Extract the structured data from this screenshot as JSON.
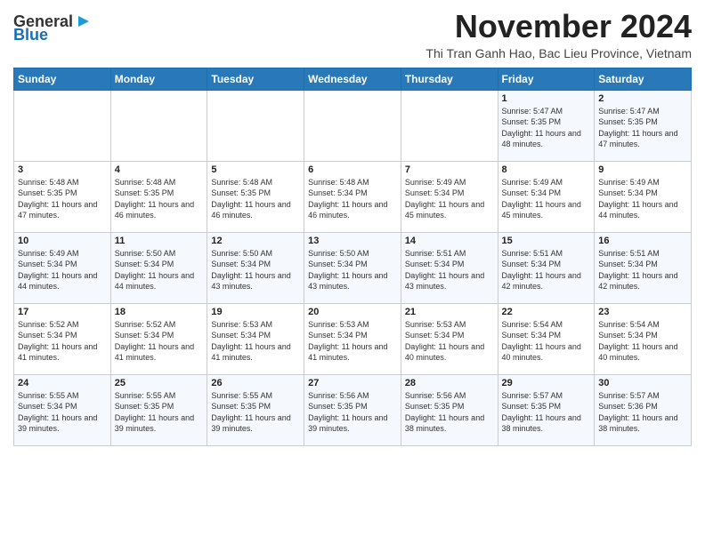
{
  "header": {
    "logo_line1": "General",
    "logo_line2": "Blue",
    "month": "November 2024",
    "location": "Thi Tran Ganh Hao, Bac Lieu Province, Vietnam"
  },
  "days_of_week": [
    "Sunday",
    "Monday",
    "Tuesday",
    "Wednesday",
    "Thursday",
    "Friday",
    "Saturday"
  ],
  "weeks": [
    [
      {
        "day": "",
        "info": ""
      },
      {
        "day": "",
        "info": ""
      },
      {
        "day": "",
        "info": ""
      },
      {
        "day": "",
        "info": ""
      },
      {
        "day": "",
        "info": ""
      },
      {
        "day": "1",
        "info": "Sunrise: 5:47 AM\nSunset: 5:35 PM\nDaylight: 11 hours and 48 minutes."
      },
      {
        "day": "2",
        "info": "Sunrise: 5:47 AM\nSunset: 5:35 PM\nDaylight: 11 hours and 47 minutes."
      }
    ],
    [
      {
        "day": "3",
        "info": "Sunrise: 5:48 AM\nSunset: 5:35 PM\nDaylight: 11 hours and 47 minutes."
      },
      {
        "day": "4",
        "info": "Sunrise: 5:48 AM\nSunset: 5:35 PM\nDaylight: 11 hours and 46 minutes."
      },
      {
        "day": "5",
        "info": "Sunrise: 5:48 AM\nSunset: 5:35 PM\nDaylight: 11 hours and 46 minutes."
      },
      {
        "day": "6",
        "info": "Sunrise: 5:48 AM\nSunset: 5:34 PM\nDaylight: 11 hours and 46 minutes."
      },
      {
        "day": "7",
        "info": "Sunrise: 5:49 AM\nSunset: 5:34 PM\nDaylight: 11 hours and 45 minutes."
      },
      {
        "day": "8",
        "info": "Sunrise: 5:49 AM\nSunset: 5:34 PM\nDaylight: 11 hours and 45 minutes."
      },
      {
        "day": "9",
        "info": "Sunrise: 5:49 AM\nSunset: 5:34 PM\nDaylight: 11 hours and 44 minutes."
      }
    ],
    [
      {
        "day": "10",
        "info": "Sunrise: 5:49 AM\nSunset: 5:34 PM\nDaylight: 11 hours and 44 minutes."
      },
      {
        "day": "11",
        "info": "Sunrise: 5:50 AM\nSunset: 5:34 PM\nDaylight: 11 hours and 44 minutes."
      },
      {
        "day": "12",
        "info": "Sunrise: 5:50 AM\nSunset: 5:34 PM\nDaylight: 11 hours and 43 minutes."
      },
      {
        "day": "13",
        "info": "Sunrise: 5:50 AM\nSunset: 5:34 PM\nDaylight: 11 hours and 43 minutes."
      },
      {
        "day": "14",
        "info": "Sunrise: 5:51 AM\nSunset: 5:34 PM\nDaylight: 11 hours and 43 minutes."
      },
      {
        "day": "15",
        "info": "Sunrise: 5:51 AM\nSunset: 5:34 PM\nDaylight: 11 hours and 42 minutes."
      },
      {
        "day": "16",
        "info": "Sunrise: 5:51 AM\nSunset: 5:34 PM\nDaylight: 11 hours and 42 minutes."
      }
    ],
    [
      {
        "day": "17",
        "info": "Sunrise: 5:52 AM\nSunset: 5:34 PM\nDaylight: 11 hours and 41 minutes."
      },
      {
        "day": "18",
        "info": "Sunrise: 5:52 AM\nSunset: 5:34 PM\nDaylight: 11 hours and 41 minutes."
      },
      {
        "day": "19",
        "info": "Sunrise: 5:53 AM\nSunset: 5:34 PM\nDaylight: 11 hours and 41 minutes."
      },
      {
        "day": "20",
        "info": "Sunrise: 5:53 AM\nSunset: 5:34 PM\nDaylight: 11 hours and 41 minutes."
      },
      {
        "day": "21",
        "info": "Sunrise: 5:53 AM\nSunset: 5:34 PM\nDaylight: 11 hours and 40 minutes."
      },
      {
        "day": "22",
        "info": "Sunrise: 5:54 AM\nSunset: 5:34 PM\nDaylight: 11 hours and 40 minutes."
      },
      {
        "day": "23",
        "info": "Sunrise: 5:54 AM\nSunset: 5:34 PM\nDaylight: 11 hours and 40 minutes."
      }
    ],
    [
      {
        "day": "24",
        "info": "Sunrise: 5:55 AM\nSunset: 5:34 PM\nDaylight: 11 hours and 39 minutes."
      },
      {
        "day": "25",
        "info": "Sunrise: 5:55 AM\nSunset: 5:35 PM\nDaylight: 11 hours and 39 minutes."
      },
      {
        "day": "26",
        "info": "Sunrise: 5:55 AM\nSunset: 5:35 PM\nDaylight: 11 hours and 39 minutes."
      },
      {
        "day": "27",
        "info": "Sunrise: 5:56 AM\nSunset: 5:35 PM\nDaylight: 11 hours and 39 minutes."
      },
      {
        "day": "28",
        "info": "Sunrise: 5:56 AM\nSunset: 5:35 PM\nDaylight: 11 hours and 38 minutes."
      },
      {
        "day": "29",
        "info": "Sunrise: 5:57 AM\nSunset: 5:35 PM\nDaylight: 11 hours and 38 minutes."
      },
      {
        "day": "30",
        "info": "Sunrise: 5:57 AM\nSunset: 5:36 PM\nDaylight: 11 hours and 38 minutes."
      }
    ]
  ]
}
